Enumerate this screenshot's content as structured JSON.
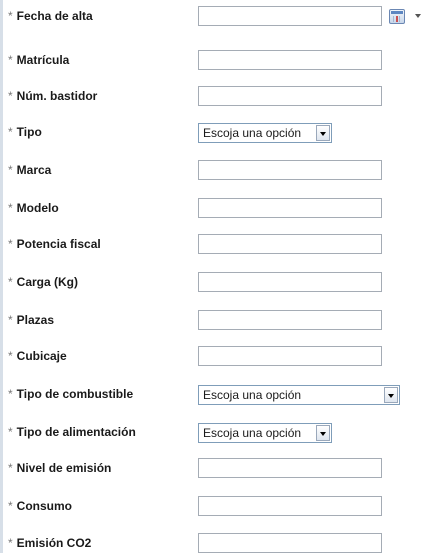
{
  "form": {
    "required_marker": "*",
    "select_placeholder": "Escoja una opción",
    "fields": {
      "fecha_alta": {
        "label": "Fecha de alta",
        "value": ""
      },
      "matricula": {
        "label": "Matrícula",
        "value": ""
      },
      "num_bastidor": {
        "label": "Núm. bastidor",
        "value": ""
      },
      "tipo": {
        "label": "Tipo",
        "selected": "Escoja una opción"
      },
      "marca": {
        "label": "Marca",
        "value": ""
      },
      "modelo": {
        "label": "Modelo",
        "value": ""
      },
      "potencia_fiscal": {
        "label": "Potencia fiscal",
        "value": ""
      },
      "carga": {
        "label": "Carga (Kg)",
        "value": ""
      },
      "plazas": {
        "label": "Plazas",
        "value": ""
      },
      "cubicaje": {
        "label": "Cubicaje",
        "value": ""
      },
      "tipo_combustible": {
        "label": "Tipo de combustible",
        "selected": "Escoja una opción"
      },
      "tipo_alimentacion": {
        "label": "Tipo de alimentación",
        "selected": "Escoja una opción"
      },
      "nivel_emision": {
        "label": "Nivel de emisión",
        "value": ""
      },
      "consumo": {
        "label": "Consumo",
        "value": ""
      },
      "emision_co2": {
        "label": "Emisión CO2",
        "value": ""
      }
    }
  },
  "icons": {
    "calendar": "calendar-icon",
    "calendar_dropdown": "chevron-down-icon",
    "select_dropdown": "chevron-down-icon"
  }
}
